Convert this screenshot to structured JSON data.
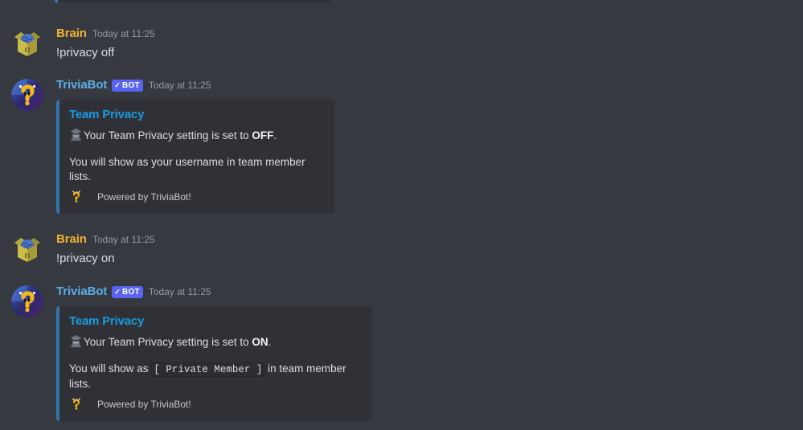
{
  "theme": {
    "background": "#36393f",
    "embed_background": "#2f3136",
    "embed_accent": "#3572b0",
    "embed_title_color": "#1a9ae0",
    "bot_name_color": "#5aaee8",
    "user_name_color": "#f0b232",
    "bot_badge_color": "#5865f2",
    "text_color": "#dbdee1",
    "timestamp_color": "#949ba4"
  },
  "bot_badge": {
    "label": "BOT",
    "check": "✓"
  },
  "messages": [
    {
      "id": "msg-privacy-off-command",
      "author": "Brain",
      "author_type": "user",
      "timestamp": "Today at 11:25",
      "avatar_icon": "brain-in-box-avatar",
      "content": "!privacy off"
    },
    {
      "id": "msg-privacy-off-embed",
      "author": "TriviaBot",
      "author_type": "bot",
      "timestamp": "Today at 11:25",
      "avatar_icon": "triviabot-avatar",
      "embed": {
        "title": "Team Privacy",
        "emoji": "detective-emoji",
        "desc_prefix": "Your Team Privacy setting is set to ",
        "desc_value": "OFF",
        "desc_suffix": ".",
        "detail_prefix": "You will show as your username in team member lists.",
        "detail_code": "",
        "detail_suffix": "",
        "footer_text": "Powered by TriviaBot!",
        "footer_icon": "triviabot-footer-icon"
      }
    },
    {
      "id": "msg-privacy-on-command",
      "author": "Brain",
      "author_type": "user",
      "timestamp": "Today at 11:25",
      "avatar_icon": "brain-in-box-avatar",
      "content": "!privacy on"
    },
    {
      "id": "msg-privacy-on-embed",
      "author": "TriviaBot",
      "author_type": "bot",
      "timestamp": "Today at 11:25",
      "avatar_icon": "triviabot-avatar",
      "embed": {
        "title": "Team Privacy",
        "emoji": "detective-emoji",
        "desc_prefix": "Your Team Privacy setting is set to ",
        "desc_value": "ON",
        "desc_suffix": ".",
        "detail_prefix": "You will show as ",
        "detail_code": "[ Private Member ]",
        "detail_suffix": " in team member lists.",
        "footer_text": "Powered by TriviaBot!",
        "footer_icon": "triviabot-footer-icon"
      }
    }
  ]
}
